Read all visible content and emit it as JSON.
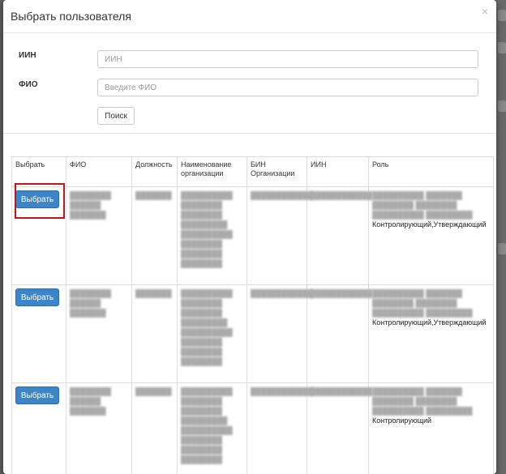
{
  "modal": {
    "title": "Выбрать пользователя",
    "close_label": "×"
  },
  "form": {
    "iin_label": "ИИН",
    "iin_placeholder": "ИИН",
    "fio_label": "ФИО",
    "fio_placeholder": "Введите ФИО",
    "search_button": "Поиск"
  },
  "table": {
    "headers": [
      "Выбрать",
      "ФИО",
      "Должность",
      "Наименование организации",
      "БИН Организации",
      "ИИН",
      "Роль"
    ],
    "rows": [
      {
        "button": "Выбрать",
        "role_visible": "Контролирующий,Утверждающий"
      },
      {
        "button": "Выбрать",
        "role_visible": "Контролирующий,Утверждающий"
      },
      {
        "button": "Выбрать",
        "role_visible": "Контролирующий"
      }
    ]
  },
  "colors": {
    "primary_button": "#3c85c9",
    "highlight": "#c0141e"
  }
}
